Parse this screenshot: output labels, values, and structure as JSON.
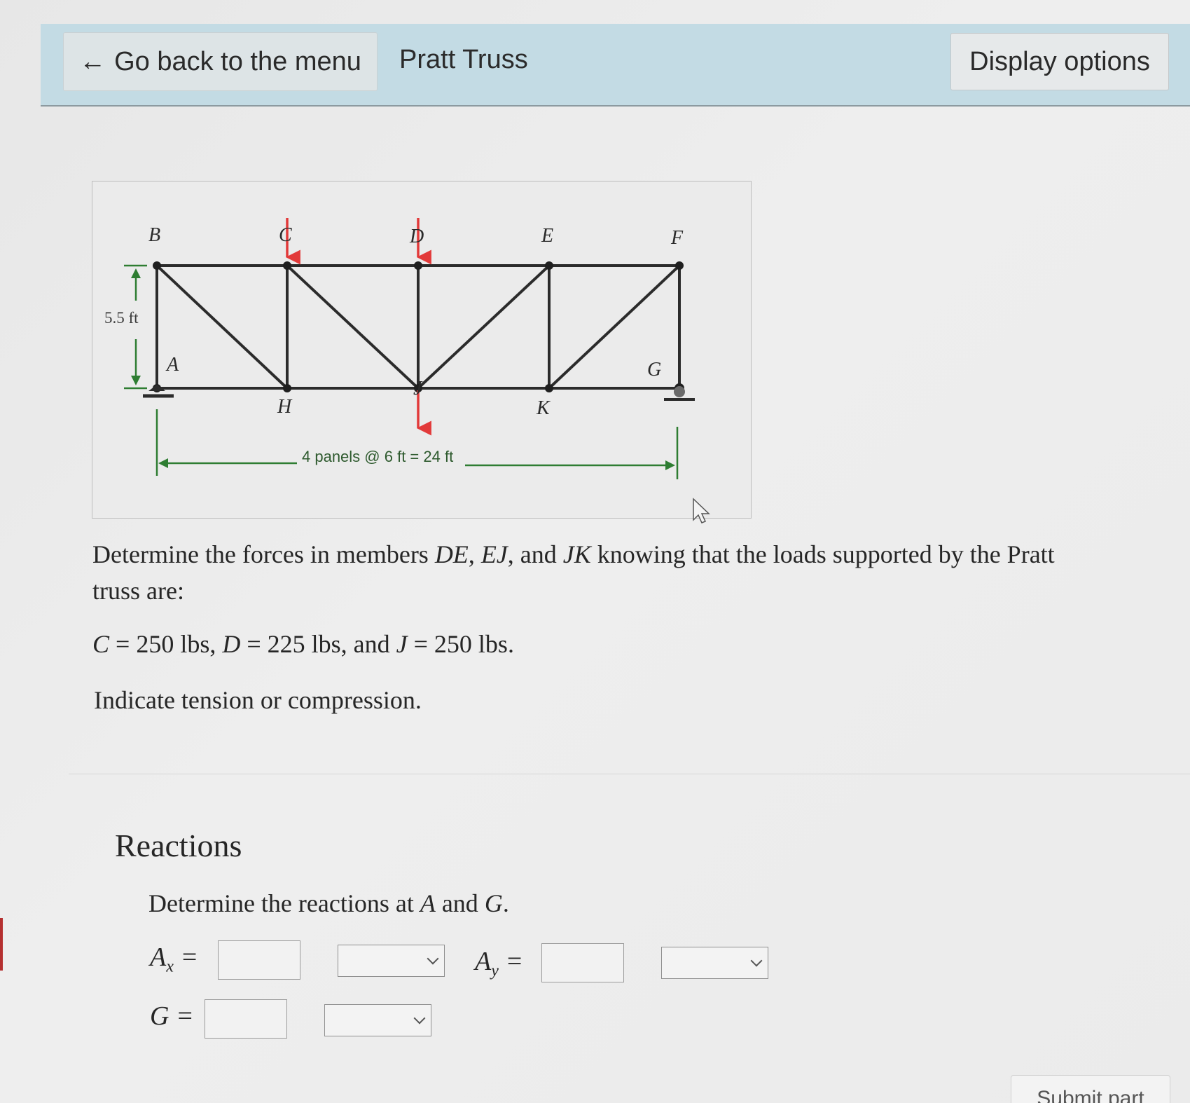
{
  "header": {
    "back_arrow": "←",
    "back_label": "Go back to the menu",
    "title": "Pratt Truss",
    "display_options_label": "Display options"
  },
  "figure": {
    "node_labels": {
      "A": "A",
      "B": "B",
      "C": "C",
      "D": "D",
      "E": "E",
      "F": "F",
      "G": "G",
      "H": "H",
      "J": "J",
      "K": "K"
    },
    "height_label": "5.5 ft",
    "span_label": "4 panels @ 6 ft = 24 ft",
    "member_color": "#2b2b2b",
    "load_arrow_color": "#e23a3a",
    "dimension_color": "#2e7d32"
  },
  "problem": {
    "intro_1": "Determine the forces in members ",
    "m1": "DE",
    "sep1": ", ",
    "m2": "EJ",
    "sep2": ", and ",
    "m3": "JK",
    "intro_2": " knowing that the loads supported by the Pratt truss are:",
    "loads": {
      "c_var": "C",
      "c_val": " = 250 lbs, ",
      "d_var": "D",
      "d_val": " = 225 lbs, and ",
      "j_var": "J",
      "j_val": " = 250 lbs."
    },
    "indicate": "Indicate tension or compression."
  },
  "reactions": {
    "heading": "Reactions",
    "prompt_a": "Determine the reactions at ",
    "prompt_var_a": "A",
    "prompt_and": " and ",
    "prompt_var_g": "G",
    "prompt_end": ".",
    "ax_label": "A",
    "ax_sub": "x",
    "ay_label": "A",
    "ay_sub": "y",
    "g_label": "G",
    "equals": "=",
    "ax_value": "",
    "ay_value": "",
    "g_value": "",
    "ax_direction": "",
    "ay_direction": "",
    "g_direction": ""
  },
  "submit_label": "Submit part"
}
